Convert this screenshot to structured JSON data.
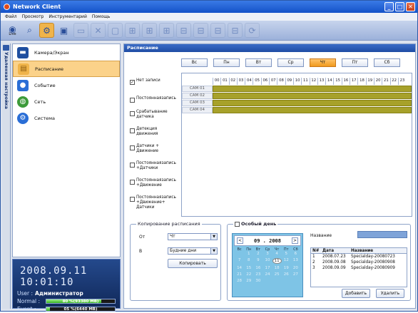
{
  "app": {
    "title": "Network Client"
  },
  "menu": [
    "Файл",
    "Просмотр",
    "Инструментарий",
    "Помощь"
  ],
  "toolbar": {
    "first_label": "Live"
  },
  "side_tab": {
    "label": "Удаленная настройка"
  },
  "nav": [
    {
      "label": "Камера/Экран",
      "icon": "monitor-icon",
      "color": "#1f4fa0"
    },
    {
      "label": "Расписание",
      "icon": "schedule-icon",
      "color": "#f0b44a",
      "selected": true
    },
    {
      "label": "Событие",
      "icon": "event-icon",
      "color": "#2a6ed6"
    },
    {
      "label": "Сеть",
      "icon": "network-globe-icon",
      "color": "#3c9a3a"
    },
    {
      "label": "Система",
      "icon": "system-gear-icon",
      "color": "#2a6ed6"
    }
  ],
  "status": {
    "datetime": "2008.09.11 10:01:10",
    "user_label": "User :",
    "user_value": "Администратор",
    "normal_label": "Normal :",
    "normal_text": "80 %(93380 MB)",
    "normal_percent": 80,
    "event_label": "Event :",
    "event_text": "05 %(6440 MB)",
    "event_percent": 5
  },
  "main": {
    "header": "Расписание"
  },
  "days": [
    "Вс",
    "Пн",
    "Вт",
    "Ср",
    "Чт",
    "Пт",
    "Сб"
  ],
  "selected_day": "Чт",
  "hours": [
    "00",
    "01",
    "02",
    "03",
    "04",
    "05",
    "06",
    "07",
    "08",
    "09",
    "10",
    "11",
    "12",
    "13",
    "14",
    "15",
    "16",
    "17",
    "18",
    "19",
    "20",
    "21",
    "22",
    "23"
  ],
  "cameras": [
    "CAM 01",
    "CAM 02",
    "CAM 03",
    "CAM 04"
  ],
  "record_options": [
    {
      "label": "Нет записи",
      "checked": true
    },
    {
      "label": "Постояннаязапись",
      "checked": false
    },
    {
      "label": "Срабатывание датчика",
      "checked": false
    },
    {
      "label": "Детекция движения",
      "checked": false
    },
    {
      "label": "Датчики + Движение",
      "checked": false
    },
    {
      "label": "Постояннаязапись +Датчики",
      "checked": false
    },
    {
      "label": "Постояннаязапись +Движение",
      "checked": false
    },
    {
      "label": "Постояннаязапись +Движение+ Датчики",
      "checked": false
    }
  ],
  "copy": {
    "legend": "Копирование расписания",
    "from_label": "От",
    "from_value": "Чт",
    "to_label": "В",
    "to_value": "Будние дни",
    "button": "Копировать"
  },
  "special": {
    "checkbox_label": "Особый день",
    "month": "09 . 2008",
    "weekdays": [
      "Вс",
      "Пн",
      "Вт",
      "Ср",
      "Чт",
      "Пт",
      "Сб"
    ],
    "days": [
      "",
      "1",
      "2",
      "3",
      "4",
      "5",
      "6",
      "7",
      "8",
      "9",
      "10",
      "11",
      "12",
      "13",
      "14",
      "15",
      "16",
      "17",
      "18",
      "19",
      "20",
      "21",
      "22",
      "23",
      "24",
      "25",
      "26",
      "27",
      "28",
      "29",
      "30"
    ],
    "current_day": "11",
    "name_label": "Название",
    "table_headers": [
      "N#",
      "Дата",
      "Название"
    ],
    "rows": [
      [
        "1",
        "2008.07.23",
        "Specialday-20080723"
      ],
      [
        "2",
        "2008.09.08",
        "Specialday-20080908"
      ],
      [
        "3",
        "2008.09.09",
        "Specialday-20080909"
      ]
    ],
    "add_button": "Добавить",
    "delete_button": "Удалить"
  }
}
